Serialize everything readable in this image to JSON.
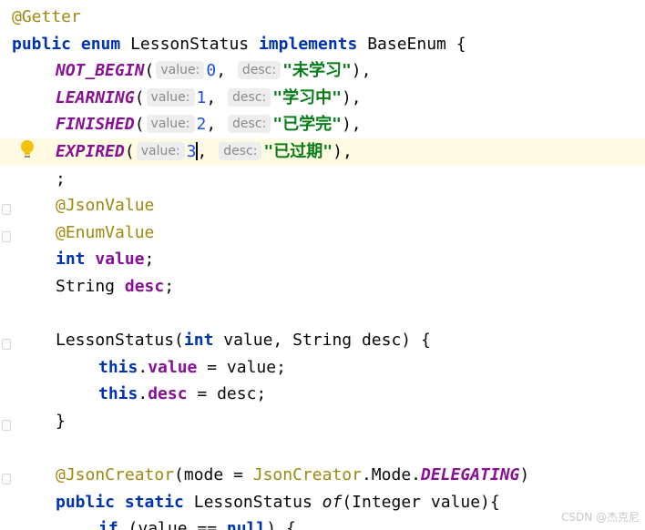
{
  "code": {
    "l1": {
      "annotation": "@Getter"
    },
    "l2": {
      "kw_public": "public",
      "kw_enum": "enum",
      "class_name": "LessonStatus",
      "kw_implements": "implements",
      "interface_name": "BaseEnum",
      "brace": "{"
    },
    "enum_constants": [
      {
        "name": "NOT_BEGIN",
        "value_hint": "value:",
        "value": "0",
        "desc_hint": "desc:",
        "desc": "\"未学习\"",
        "end": "),"
      },
      {
        "name": "LEARNING",
        "value_hint": "value:",
        "value": "1",
        "desc_hint": "desc:",
        "desc": "\"学习中\"",
        "end": "),"
      },
      {
        "name": "FINISHED",
        "value_hint": "value:",
        "value": "2",
        "desc_hint": "desc:",
        "desc": "\"已学完\"",
        "end": "),"
      },
      {
        "name": "EXPIRED",
        "value_hint": "value:",
        "value": "3",
        "desc_hint": "desc:",
        "desc": "\"已过期\"",
        "end": "),"
      }
    ],
    "l7": {
      "semicolon": ";"
    },
    "l8": {
      "annotation": "@JsonValue"
    },
    "l9": {
      "annotation": "@EnumValue"
    },
    "l10": {
      "type": "int",
      "field": "value",
      "semi": ";"
    },
    "l11": {
      "type": "String",
      "field": "desc",
      "semi": ";"
    },
    "l13": {
      "name": "LessonStatus(",
      "kw_int": "int",
      "params": " value, String desc) {"
    },
    "l14": {
      "kw_this": "this",
      "dot": ".",
      "field": "value",
      "rest": " = value;"
    },
    "l15": {
      "kw_this": "this",
      "dot": ".",
      "field": "desc",
      "rest": " = desc;"
    },
    "l16": {
      "brace": "}"
    },
    "l18": {
      "annotation": "@JsonCreator",
      "mid": "(mode = ",
      "cls": "JsonCreator",
      "dot": ".Mode.",
      "const": "DELEGATING",
      "close": ")"
    },
    "l19": {
      "kw_public": "public",
      "kw_static": "static",
      "type": "LessonStatus",
      "method": "of",
      "params": "(Integer value){"
    },
    "l20": {
      "kw_if": "if",
      "cond": " (value == ",
      "kw_null": "null",
      "rest": ") {"
    }
  },
  "watermark": "CSDN @杰克尼",
  "icons": [
    "lightbulb-icon",
    "fold-marker-icon"
  ]
}
